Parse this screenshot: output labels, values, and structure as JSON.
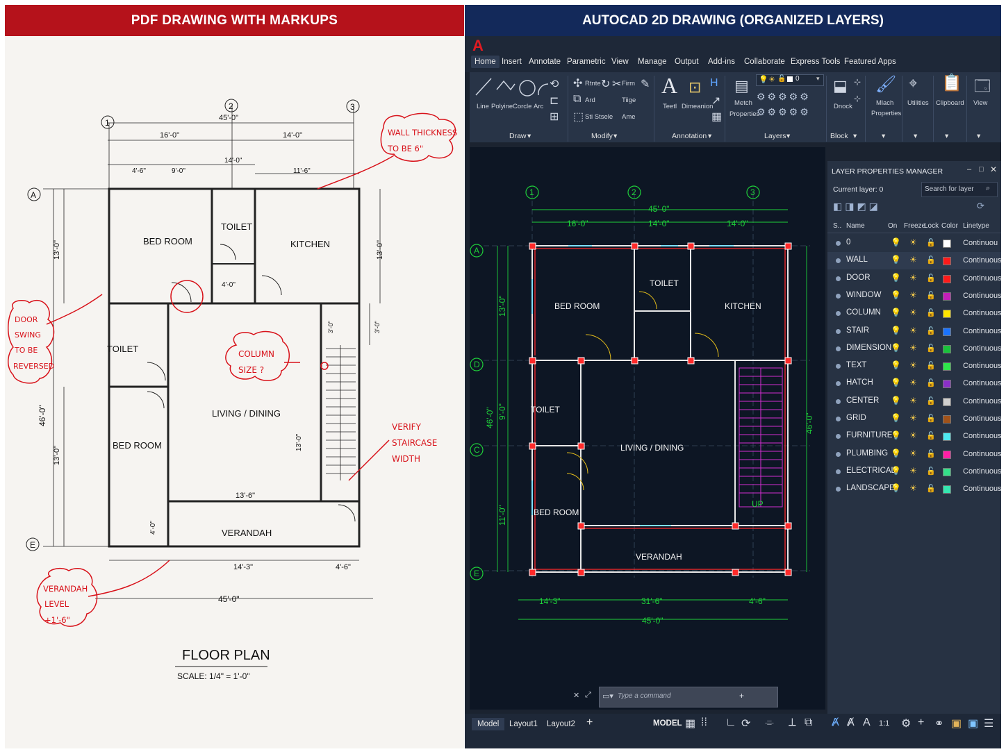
{
  "left_panel": {
    "header": "PDF DRAWING WITH MARKUPS",
    "grid_bubbles": [
      "1",
      "2",
      "3",
      "A",
      "E"
    ],
    "dimensions": {
      "overall_top": "45'-0\"",
      "top_left": "16'-0\"",
      "top_right": "14'-0\"",
      "top_sub1": "4'-6\"",
      "top_sub2": "9'-0\"",
      "top_sub3": "14'-0\"",
      "top_sub4": "11'-6\"",
      "left_upper": "13'-0\"",
      "left_overall": "46'-0\"",
      "left_lower": "13'-0\"",
      "right_upper": "13'-0\"",
      "right_mid": "3'-0\"",
      "right_mid2": "3'-0\"",
      "toilet_dim": "4'-0\"",
      "living_dim": "13'-0\"",
      "living_width": "13'-6\"",
      "verandah_dim": "4'-0\"",
      "bottom_mid": "14'-3\"",
      "bottom_right": "4'-6\"",
      "overall_bottom": "45'-0\""
    },
    "rooms": {
      "bed_room_1": "BED ROOM",
      "toilet_1": "TOILET",
      "kitchen": "KITCHEN",
      "toilet_2": "TOILET",
      "living": "LIVING / DINING",
      "bed_room_2": "BED ROOM",
      "verandah": "VERANDAH"
    },
    "markups": {
      "wall": [
        "WALL THICKNESS",
        "TO BE 6\""
      ],
      "door": [
        "DOOR",
        "SWING",
        "TO BE",
        "REVERSED"
      ],
      "column": [
        "COLUMN",
        "SIZE ?"
      ],
      "stair": [
        "VERIFY",
        "STAIRCASE",
        "WIDTH"
      ],
      "verandah": [
        "VERANDAH",
        "LEVEL",
        "+1'-6\""
      ]
    },
    "title": "FLOOR PLAN",
    "scale": "SCALE:  1/4\" = 1'-0\""
  },
  "right_panel": {
    "header": "AUTOCAD 2D DRAWING (ORGANIZED LAYERS)",
    "logo": "A",
    "menu": [
      "Home",
      "Insert",
      "Annotate",
      "Parametric",
      "View",
      "Manage",
      "Output",
      "Add-ins",
      "Collaborate",
      "Express Tools",
      "Featured Apps"
    ],
    "ribbon": {
      "draw_tools": [
        "Line",
        "Polyine",
        "Corcle",
        "Arc"
      ],
      "modify_tools": [
        "Rtnte",
        "Firm",
        "Ard",
        "Tiige",
        "Sti Stsele",
        "Ame"
      ],
      "text_tool": "Teetl",
      "dimension_tool": "Dimeanion",
      "match_props": [
        "Metch",
        "Properties"
      ],
      "layer_value": "0",
      "block_tool": "Dnock",
      "match_props2": [
        "Mlach",
        "Properties"
      ],
      "utilities": "Utilities",
      "clipboard": "Clipboard",
      "view": "View",
      "groups": [
        "Draw",
        "Modify",
        "Annotation",
        "Layers",
        "Block"
      ]
    },
    "drawing": {
      "grid_bubbles": [
        "1",
        "2",
        "3",
        "A",
        "D",
        "C",
        "E"
      ],
      "dims": {
        "top_overall": "45'-0\"",
        "top_left": "16'-0\"",
        "top_mid": "14'-0\"",
        "top_right": "14'-0\"",
        "left_upper": "13'-0\"",
        "left_overall": "46'-0\"",
        "left_mid": "9'-0\"",
        "left_lower": "11'-0\"",
        "right_overall": "46'-0\"",
        "bottom_left": "14'-3\"",
        "bottom_mid": "31'-6\"",
        "bottom_right": "4'-6\"",
        "bottom_overall": "45'-0\""
      },
      "rooms": {
        "bed_room_1": "BED ROOM",
        "toilet_1": "TOILET",
        "kitchen": "KITCHEN",
        "toilet_2": "TOILET",
        "living": "LIVING / DINING",
        "bed_room_2": "BED ROOM",
        "verandah": "VERANDAH",
        "stair_up": "UP"
      }
    },
    "layer_manager": {
      "title": "LAYER PROPERTIES MANAGER",
      "current_layer": "Current layer: 0",
      "search_placeholder": "Search for layer",
      "columns": [
        "S..",
        "Name",
        "On",
        "Freeze",
        "Lock",
        "Color",
        "Linetype"
      ],
      "layers": [
        {
          "name": "0",
          "color": "#ffffff",
          "linetype": "Continuou"
        },
        {
          "name": "WALL",
          "color": "#ff1a1a",
          "linetype": "Continuous"
        },
        {
          "name": "DOOR",
          "color": "#ff1a1a",
          "linetype": "Continuous"
        },
        {
          "name": "WINDOW",
          "color": "#c21fb8",
          "linetype": "Continuous"
        },
        {
          "name": "COLUMN",
          "color": "#ffe600",
          "linetype": "Continuous"
        },
        {
          "name": "STAIR",
          "color": "#1a73ff",
          "linetype": "Continuous"
        },
        {
          "name": "DIMENSION",
          "color": "#19c23b",
          "linetype": "Continuous"
        },
        {
          "name": "TEXT",
          "color": "#2ee64b",
          "linetype": "Continuous"
        },
        {
          "name": "HATCH",
          "color": "#8b2fc9",
          "linetype": "Continuous"
        },
        {
          "name": "CENTER",
          "color": "#d0d0d0",
          "linetype": "Continuous"
        },
        {
          "name": "GRID",
          "color": "#a0521a",
          "linetype": "Continuous"
        },
        {
          "name": "FURNITURE",
          "color": "#4ee8f0",
          "linetype": "Continuous"
        },
        {
          "name": "PLUMBING",
          "color": "#ff1fa6",
          "linetype": "Continuous"
        },
        {
          "name": "ELECTRICAL",
          "color": "#34e08a",
          "linetype": "Continuous"
        },
        {
          "name": "LANDSCAPE",
          "color": "#35e6b0",
          "linetype": "Continuous"
        }
      ]
    },
    "command_placeholder": "Type a command",
    "tabs": [
      "Model",
      "Layout1",
      "Layout2",
      "+"
    ],
    "status": {
      "model": "MODEL",
      "scale": "1:1"
    }
  }
}
